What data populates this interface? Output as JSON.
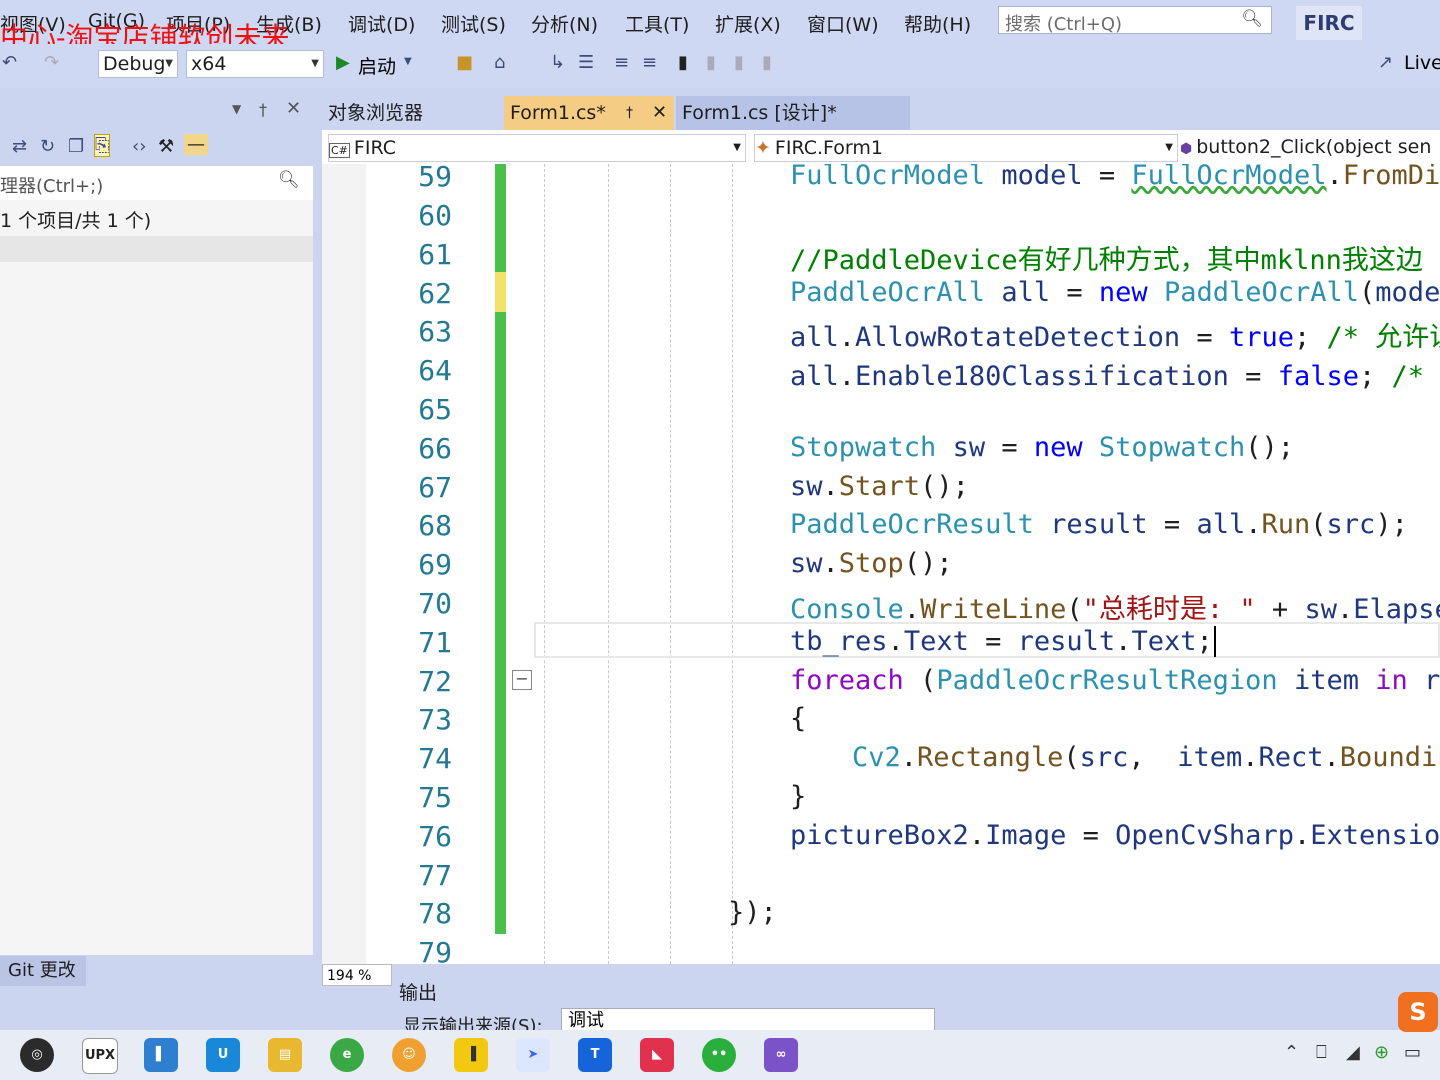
{
  "menu": {
    "items": [
      "视图(V)",
      "Git(G)",
      "项目(P)",
      "生成(B)",
      "调试(D)",
      "测试(S)",
      "分析(N)",
      "工具(T)",
      "扩展(X)",
      "窗口(W)",
      "帮助(H)"
    ],
    "search_placeholder": "搜索 (Ctrl+Q)",
    "solution_name": "FIRC",
    "watermark": "中心-淘宝店铺软创未来"
  },
  "toolbar": {
    "config": "Debug",
    "platform": "x64",
    "start_label": "启动",
    "live_share": "Live"
  },
  "left_panel": {
    "search_placeholder": "理器(Ctrl+;)",
    "count_text": "1 个项目/共 1 个)",
    "git_tab": "Git 更改"
  },
  "doc_tabs": [
    {
      "label": "对象浏览器",
      "active": false
    },
    {
      "label": "Form1.cs*",
      "active": true
    },
    {
      "label": "Form1.cs [设计]*",
      "active": false
    }
  ],
  "navbar": {
    "project": "FIRC",
    "class": "FIRC.Form1",
    "member": "button2_Click(object sen"
  },
  "editor": {
    "line_numbers": [
      "59",
      "60",
      "61",
      "62",
      "63",
      "64",
      "65",
      "66",
      "67",
      "68",
      "69",
      "70",
      "71",
      "72",
      "73",
      "74",
      "75",
      "76",
      "77",
      "78",
      "79"
    ],
    "zoom": "194 %"
  },
  "output": {
    "title": "输出",
    "source_label": "显示输出来源(S):",
    "source_value": "调试"
  },
  "taskbar": {
    "apps": [
      "obs-icon",
      "upx-icon",
      "notes-icon",
      "ublock-icon",
      "explorer-icon",
      "browser-icon",
      "media-icon",
      "powerbi-icon",
      "feishu-icon",
      "todo-icon",
      "app-icon",
      "wechat-icon",
      "visualstudio-icon"
    ]
  },
  "colors": {
    "accent": "#cfd8f2",
    "change_bar": "#48c04a",
    "keyword": "#0000ff",
    "type": "#2b91af"
  }
}
